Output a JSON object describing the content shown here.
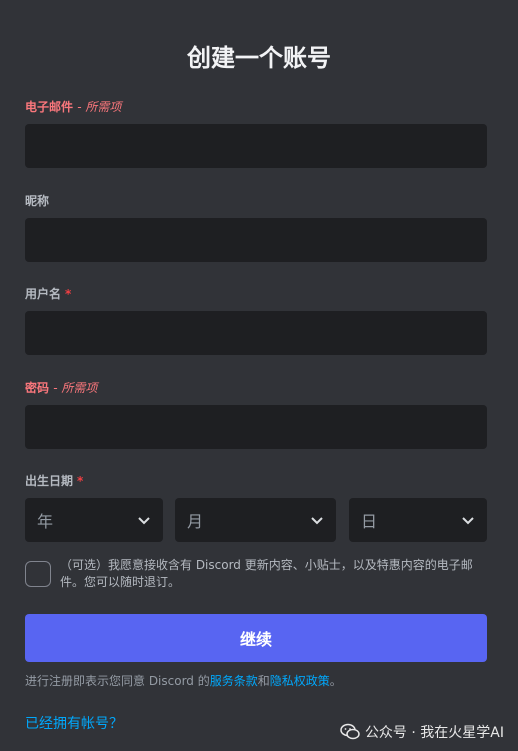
{
  "title": "创建一个账号",
  "fields": {
    "email": {
      "label": "电子邮件",
      "note": "- 所需项"
    },
    "nickname": {
      "label": "昵称"
    },
    "username": {
      "label": "用户名",
      "required_mark": "*"
    },
    "password": {
      "label": "密码",
      "note": "- 所需项"
    }
  },
  "birth": {
    "label": "出生日期",
    "required_mark": "*",
    "year": "年",
    "month": "月",
    "day": "日"
  },
  "optin": "（可选）我愿意接收含有 Discord 更新内容、小贴士，以及特惠内容的电子邮件。您可以随时退订。",
  "continue_label": "继续",
  "terms": {
    "prefix": "进行注册即表示您同意 Discord 的",
    "tos": "服务条款",
    "and": "和",
    "privacy": "隐私权政策",
    "suffix": "。"
  },
  "login_link": "已经拥有帐号？",
  "watermark": "公众号 · 我在火星学AI",
  "colors": {
    "accent": "#5865f2",
    "link": "#00a8fc",
    "error": "#fa777c",
    "background": "#313338",
    "input": "#1e1f22"
  }
}
